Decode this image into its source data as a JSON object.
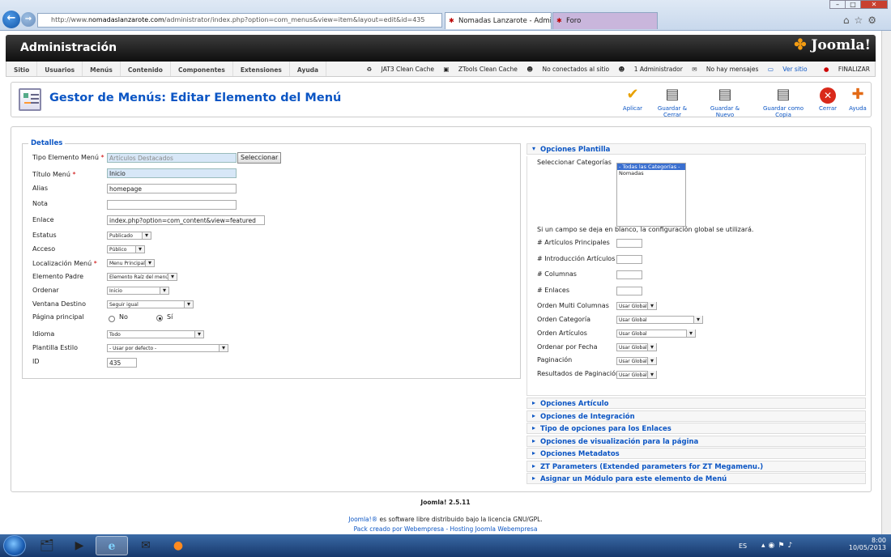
{
  "browser": {
    "url_prefix": "http://www.",
    "url_host": "nomadaslanzarote.com",
    "url_path": "/administrator/index.php?option=com_menus&view=item&layout=edit&id=435",
    "tabs": [
      {
        "label": "Nomadas Lanzarote - Admi..."
      },
      {
        "label": "Foro"
      }
    ]
  },
  "header": {
    "title": "Administración",
    "brand": "Joomla!"
  },
  "menu": [
    "Sitio",
    "Usuarios",
    "Menús",
    "Contenido",
    "Componentes",
    "Extensiones",
    "Ayuda"
  ],
  "status": {
    "jat3": "JAT3 Clean Cache",
    "ztools": "ZTools Clean Cache",
    "connected": "No conectados al sitio",
    "admins": "1 Administrador",
    "messages": "No hay mensajes",
    "view_site": "Ver sitio",
    "logout": "FINALIZAR"
  },
  "page": {
    "title": "Gestor de Menús: Editar Elemento del Menú"
  },
  "toolbar": {
    "apply": "Aplicar",
    "save_close": "Guardar & Cerrar",
    "save_new": "Guardar & Nuevo",
    "save_copy": "Guardar como Copia",
    "close": "Cerrar",
    "help": "Ayuda"
  },
  "details": {
    "legend": "Detalles",
    "menu_type_label": "Tipo Elemento Menú",
    "menu_type_value": "Artículos Destacados",
    "select_button": "Seleccionar",
    "title_label": "Título Menú",
    "title_value": "Inicio",
    "alias_label": "Alias",
    "alias_value": "homepage",
    "note_label": "Nota",
    "note_value": "",
    "link_label": "Enlace",
    "link_value": "index.php?option=com_content&view=featured",
    "status_label": "Estatus",
    "status_value": "Publicado",
    "access_label": "Acceso",
    "access_value": "Público",
    "location_label": "Localización Menú",
    "location_value": "Menu Principal",
    "parent_label": "Elemento Padre",
    "parent_value": "Elemento Raíz del menú",
    "order_label": "Ordenar",
    "order_value": "Inicio",
    "target_label": "Ventana Destino",
    "target_value": "Seguir igual",
    "home_label": "Página principal",
    "home_no": "No",
    "home_yes": "Sí",
    "lang_label": "Idioma",
    "lang_value": "Todo",
    "style_label": "Plantilla Estilo",
    "style_value": "- Usar por defecto -",
    "id_label": "ID",
    "id_value": "435"
  },
  "template_options": {
    "heading": "Opciones Plantilla",
    "categories_label": "Seleccionar Categorías",
    "categories": [
      "- Todas las Categorías -",
      "Nomadas"
    ],
    "hint": "Si un campo se deja en blanco, la configuración global se utilizará.",
    "leading_label": "# Artículos Principales",
    "intro_label": "# Introducción Artículos",
    "columns_label": "# Columnas",
    "links_label": "# Enlaces",
    "multi_col_label": "Orden Multi Columnas",
    "multi_col_value": "Usar Global",
    "cat_order_label": "Orden Categoría",
    "cat_order_value": "Usar Global",
    "art_order_label": "Orden Artículos",
    "art_order_value": "Usar Global",
    "date_order_label": "Ordenar por Fecha",
    "date_order_value": "Usar Global",
    "pagination_label": "Paginación",
    "pagination_value": "Usar Global",
    "pag_results_label": "Resultados de Paginación",
    "pag_results_value": "Usar Global"
  },
  "accordions": [
    "Opciones Artículo",
    "Opciones de Integración",
    "Tipo de opciones para los Enlaces",
    "Opciones de visualización para la página",
    "Opciones Metadatos",
    "ZT Parameters (Extended parameters for ZT Megamenu.)",
    "Asignar un Módulo para este elemento de Menú"
  ],
  "footer": {
    "version": "Joomla! 2.5.11",
    "license_link": "Joomla!®",
    "license_text": " es software libre distribuido bajo la licencia GNU/GPL.",
    "pack": "Pack creado por Webempresa - Hosting Joomla Webempresa"
  },
  "taskbar": {
    "lang": "ES",
    "time": "8:00",
    "date": "10/05/2013"
  },
  "colors": {
    "accent": "#0b55c4",
    "header_bg": "#1a1a1a",
    "required": "#cc0000"
  }
}
